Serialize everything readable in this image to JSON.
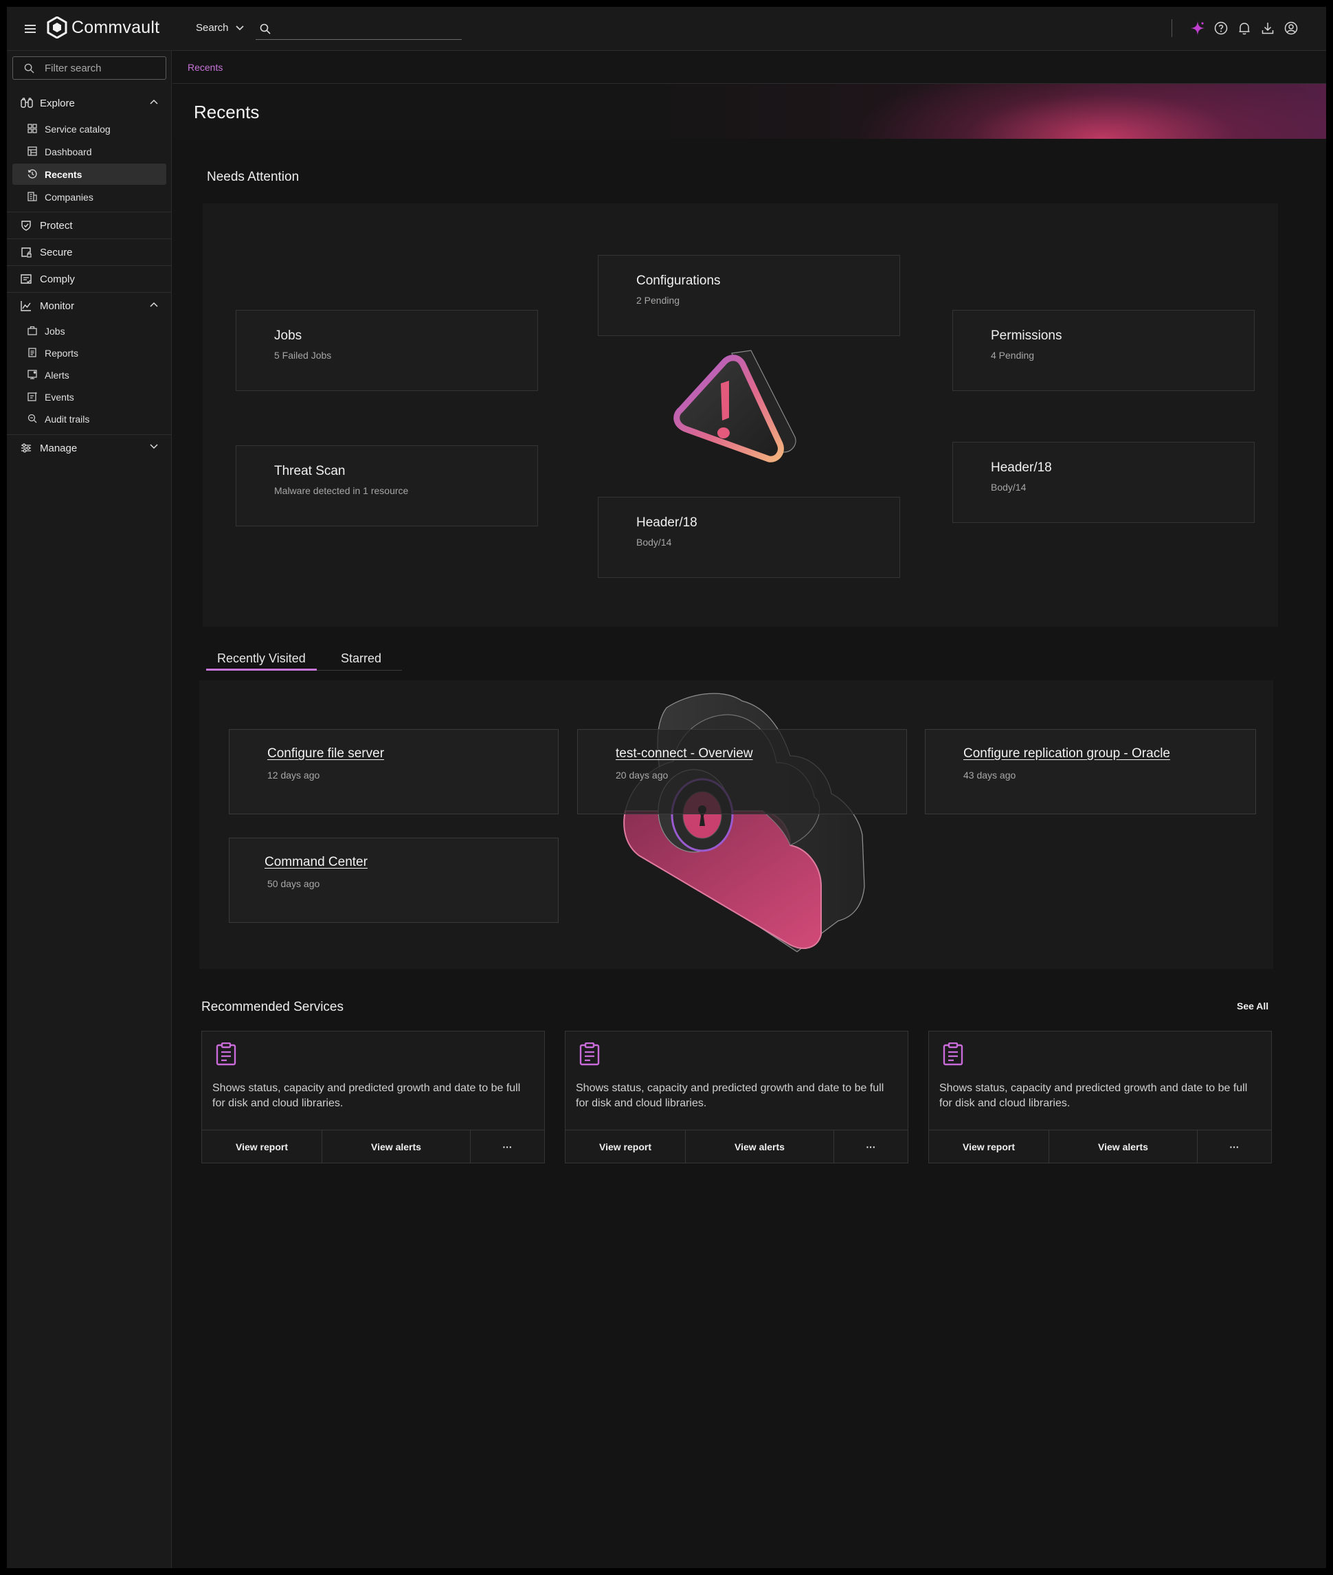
{
  "topbar": {
    "brand": "Commvault",
    "search_scope": "Search",
    "search_placeholder": "",
    "icons": [
      "ai-sparkle-icon",
      "help-icon",
      "bell-icon",
      "download-icon",
      "user-icon"
    ],
    "accent": "#c03fd0"
  },
  "sidebar": {
    "filter_placeholder": "Filter search",
    "explore": {
      "label": "Explore",
      "items": [
        {
          "label": "Service catalog",
          "icon": "grid-icon"
        },
        {
          "label": "Dashboard",
          "icon": "dashboard-icon"
        },
        {
          "label": "Recents",
          "icon": "history-icon",
          "active": true
        },
        {
          "label": "Companies",
          "icon": "building-icon"
        }
      ]
    },
    "protect": "Protect",
    "secure": "Secure",
    "comply": "Comply",
    "monitor": {
      "label": "Monitor",
      "items": [
        {
          "label": "Jobs",
          "icon": "briefcase-icon"
        },
        {
          "label": "Reports",
          "icon": "report-icon"
        },
        {
          "label": "Alerts",
          "icon": "alert-icon"
        },
        {
          "label": "Events",
          "icon": "event-icon"
        },
        {
          "label": "Audit trails",
          "icon": "audit-icon"
        }
      ]
    },
    "manage": "Manage"
  },
  "breadcrumb": "Recents",
  "page_title": "Recents",
  "needs_attention": {
    "title": "Needs Attention",
    "cards": [
      {
        "title": "Configurations",
        "subtitle": "2 Pending"
      },
      {
        "title": "Jobs",
        "subtitle": "5 Failed Jobs"
      },
      {
        "title": "Permissions",
        "subtitle": "4 Pending"
      },
      {
        "title": "Threat Scan",
        "subtitle": "Malware detected in 1 resource"
      },
      {
        "title": "Header/18",
        "subtitle": "Body/14"
      },
      {
        "title": "Header/18",
        "subtitle": "Body/14"
      }
    ]
  },
  "tabs": {
    "recently_visited": "Recently Visited",
    "starred": "Starred"
  },
  "recently_visited": [
    {
      "title": "Configure file server",
      "time": "12 days ago"
    },
    {
      "title": "test-connect - Overview",
      "time": "20 days ago"
    },
    {
      "title": "Configure replication group - Oracle",
      "time": "43 days ago"
    },
    {
      "title": "Command Center",
      "time": "50 days ago"
    }
  ],
  "recommended": {
    "title": "Recommended Services",
    "see_all": "See All",
    "cards": [
      {
        "description": "Shows status, capacity and predicted growth and date to be full for disk and cloud libraries.",
        "view_report": "View report",
        "view_alerts": "View alerts",
        "more": "···"
      },
      {
        "description": "Shows status, capacity and predicted growth and date to be full for disk and cloud libraries.",
        "view_report": "View report",
        "view_alerts": "View alerts",
        "more": "···"
      },
      {
        "description": "Shows status, capacity and predicted growth and date to be full for disk and cloud libraries.",
        "view_report": "View report",
        "view_alerts": "View alerts",
        "more": "···"
      }
    ]
  }
}
